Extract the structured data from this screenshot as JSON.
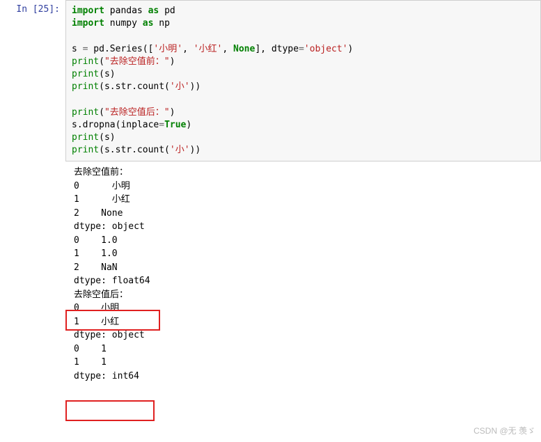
{
  "prompt": {
    "label": "In  [25]:"
  },
  "code": {
    "l1": {
      "a": "import",
      "b": " pandas ",
      "c": "as",
      "d": " pd"
    },
    "l2": {
      "a": "import",
      "b": " numpy ",
      "c": "as",
      "d": " np"
    },
    "l3": "",
    "l4": {
      "a": "s ",
      "eq": "=",
      "b": " pd.Series([",
      "s1": "'小明'",
      "c1": ", ",
      "s2": "'小红'",
      "c2": ", ",
      "none": "None",
      "d": "], dtype",
      "eq2": "=",
      "s3": "'object'",
      "e": ")"
    },
    "l5": {
      "a": "print",
      "b": "(",
      "s": "\"去除空值前：\"",
      "c": ")"
    },
    "l6": {
      "a": "print",
      "b": "(s)"
    },
    "l7": {
      "a": "print",
      "b": "(s.str.count(",
      "s": "'小'",
      "c": "))"
    },
    "l8": "",
    "l9": {
      "a": "print",
      "b": "(",
      "s": "\"去除空值后：\"",
      "c": ")"
    },
    "l10": {
      "a": "s.dropna(inplace",
      "eq": "=",
      "tr": "True",
      "b": ")"
    },
    "l11": {
      "a": "print",
      "b": "(s)"
    },
    "l12": {
      "a": "print",
      "b": "(s.str.count(",
      "s": "'小'",
      "c": "))"
    }
  },
  "output": {
    "line1": "去除空值前：",
    "line2": "0      小明",
    "line3": "1      小红",
    "line4": "2    None",
    "line5": "dtype: object",
    "line6": "0    1.0",
    "line7": "1    1.0",
    "line8": "2    NaN",
    "line9": "dtype: float64",
    "line10": "去除空值后：",
    "line11": "0    小明",
    "line12": "1    小红",
    "line13": "dtype: object",
    "line14": "0    1",
    "line15": "1    1",
    "line16": "dtype: int64"
  },
  "watermark": "CSDN @无 羡ゞ"
}
